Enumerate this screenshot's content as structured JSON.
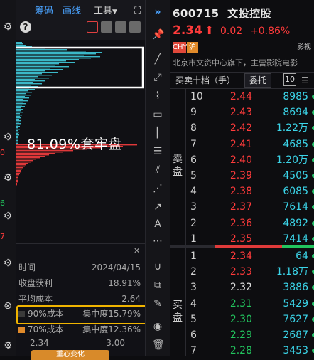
{
  "colors": {
    "up": "#ff3b3b",
    "down": "#22c55e",
    "cyan": "#3bd4e8",
    "accent": "#2e7dff",
    "highlight": "#f0b400"
  },
  "left_panel": {
    "tabs": [
      {
        "label": "筹码",
        "color": "#4aa3ff"
      },
      {
        "label": "画线",
        "color": "#4aa3ff"
      },
      {
        "label": "工具",
        "color": "#d0d0d0"
      }
    ],
    "big_label": "81.09%套牢盘",
    "stats": {
      "time_label": "时间",
      "time_value": "2024/04/15",
      "profit_label": "收盘获利",
      "profit_value": "18.91%",
      "avgcost_label": "平均成本",
      "avgcost_value": "2.64",
      "c90_label": "90%成本",
      "c90_conc": "集中度15.79%",
      "c70_label": "70%成本",
      "c70_conc": "集中度12.36%",
      "c70_low": "2.34",
      "c70_high": "3.00",
      "bottom_btn": "重心变化"
    },
    "gutter_numbers": [
      "0",
      "6",
      "7"
    ]
  },
  "toolbar": {
    "icons": [
      "pin-icon",
      "line-icon",
      "ray-icon",
      "path-icon",
      "rect-icon",
      "bars-icon",
      "fib-icon",
      "parallel-icon",
      "fan-icon",
      "arrow-icon",
      "text-icon",
      "more-icon",
      "magnet-icon",
      "copy-icon",
      "pencil-icon",
      "eye-icon",
      "trash-icon"
    ]
  },
  "quote": {
    "code": "600715",
    "name": "文投控股",
    "price": "2.34",
    "change": "0.02",
    "change_pct": "+0.86%",
    "badges": [
      "CHY",
      "沪",
      "影视"
    ],
    "description": "北京市文资中心旗下，主营影院电影",
    "tab_label": "买卖十档（手）",
    "tab_active": "委托",
    "tab_count": "10",
    "sell_label": "卖盘",
    "buy_label": "买盘",
    "asks": [
      {
        "n": "10",
        "p": "2.44",
        "v": "8985"
      },
      {
        "n": "9",
        "p": "2.43",
        "v": "8694"
      },
      {
        "n": "8",
        "p": "2.42",
        "v": "1.22万"
      },
      {
        "n": "7",
        "p": "2.41",
        "v": "4685"
      },
      {
        "n": "6",
        "p": "2.40",
        "v": "1.20万"
      },
      {
        "n": "5",
        "p": "2.39",
        "v": "4505"
      },
      {
        "n": "4",
        "p": "2.38",
        "v": "6085"
      },
      {
        "n": "3",
        "p": "2.37",
        "v": "7614"
      },
      {
        "n": "2",
        "p": "2.36",
        "v": "4892"
      },
      {
        "n": "1",
        "p": "2.35",
        "v": "7414"
      }
    ],
    "bids": [
      {
        "n": "1",
        "p": "2.34",
        "v": "64"
      },
      {
        "n": "2",
        "p": "2.33",
        "v": "1.18万"
      },
      {
        "n": "3",
        "p": "2.32",
        "v": "3886"
      },
      {
        "n": "4",
        "p": "2.31",
        "v": "5429"
      },
      {
        "n": "5",
        "p": "2.30",
        "v": "7627"
      },
      {
        "n": "6",
        "p": "2.29",
        "v": "2687"
      },
      {
        "n": "7",
        "p": "2.28",
        "v": "3453"
      }
    ]
  },
  "chips": {
    "cyan": [
      8,
      10,
      14,
      22,
      40,
      72,
      98,
      120,
      112,
      95,
      118,
      105,
      88,
      70,
      82,
      60,
      55,
      74,
      48,
      66,
      40,
      58,
      36,
      50,
      30,
      46,
      26,
      40,
      24,
      36,
      20,
      30,
      18,
      26,
      16,
      22,
      14,
      20,
      12,
      18,
      10,
      16,
      9,
      14,
      8,
      12,
      7,
      10,
      6,
      9,
      5,
      8,
      5,
      7,
      4,
      6,
      4,
      6,
      3,
      5,
      3,
      5,
      3,
      4,
      2,
      4,
      2,
      3,
      2,
      3,
      2,
      2
    ],
    "red": [
      170,
      150,
      120,
      100,
      80,
      66,
      55,
      46,
      40,
      34,
      28,
      24,
      20,
      17,
      14,
      12,
      10,
      8,
      7,
      6,
      5,
      4,
      3,
      3,
      2,
      2,
      2,
      1,
      1
    ]
  }
}
